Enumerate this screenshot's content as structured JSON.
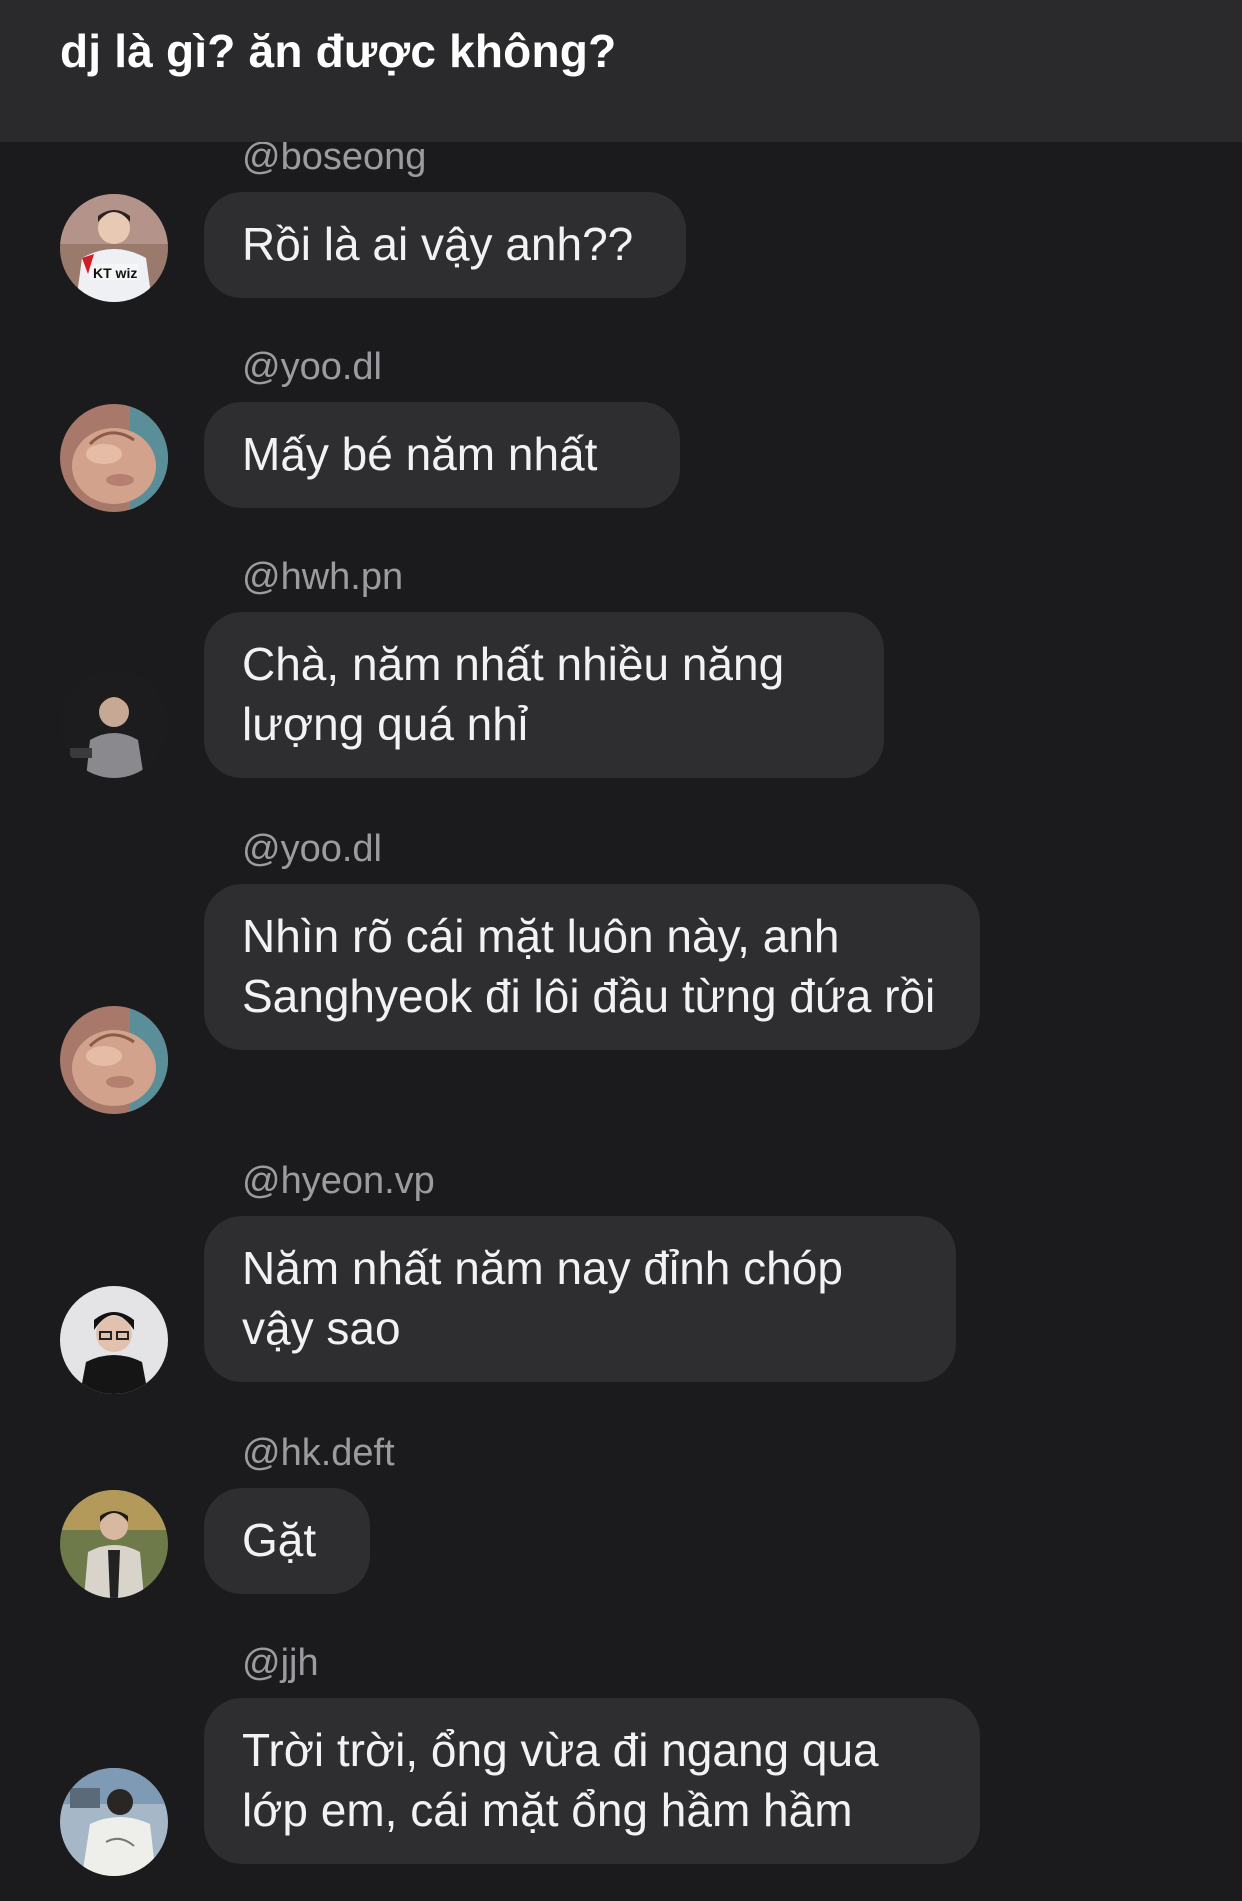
{
  "header": {
    "title": "dj là gì? ăn được không?"
  },
  "messages": [
    {
      "username": "@boseong",
      "text": "Rồi là ai vậy anh??",
      "avatar_icon": "player-avatar-kt-wiz"
    },
    {
      "username": "@yoo.dl",
      "text": "Mấy bé năm nhất",
      "avatar_icon": "cat-avatar"
    },
    {
      "username": "@hwh.pn",
      "text": "Chà, năm nhất nhiều năng lượng quá nhỉ",
      "avatar_icon": "person-dark-avatar"
    },
    {
      "username": "@yoo.dl",
      "text": "Nhìn rõ cái mặt luôn này, anh Sanghyeok đi lôi đầu từng đứa rồi",
      "avatar_icon": "cat-avatar"
    },
    {
      "username": "@hyeon.vp",
      "text": "Năm nhất năm nay đỉnh chóp vậy sao",
      "avatar_icon": "person-glasses-avatar"
    },
    {
      "username": "@hk.deft",
      "text": "Gặt",
      "avatar_icon": "person-outdoor-avatar"
    },
    {
      "username": "@jjh",
      "text": "Trời trời, ổng vừa đi ngang qua lớp em, cái mặt ổng hầm hầm",
      "avatar_icon": "person-back-avatar"
    }
  ]
}
